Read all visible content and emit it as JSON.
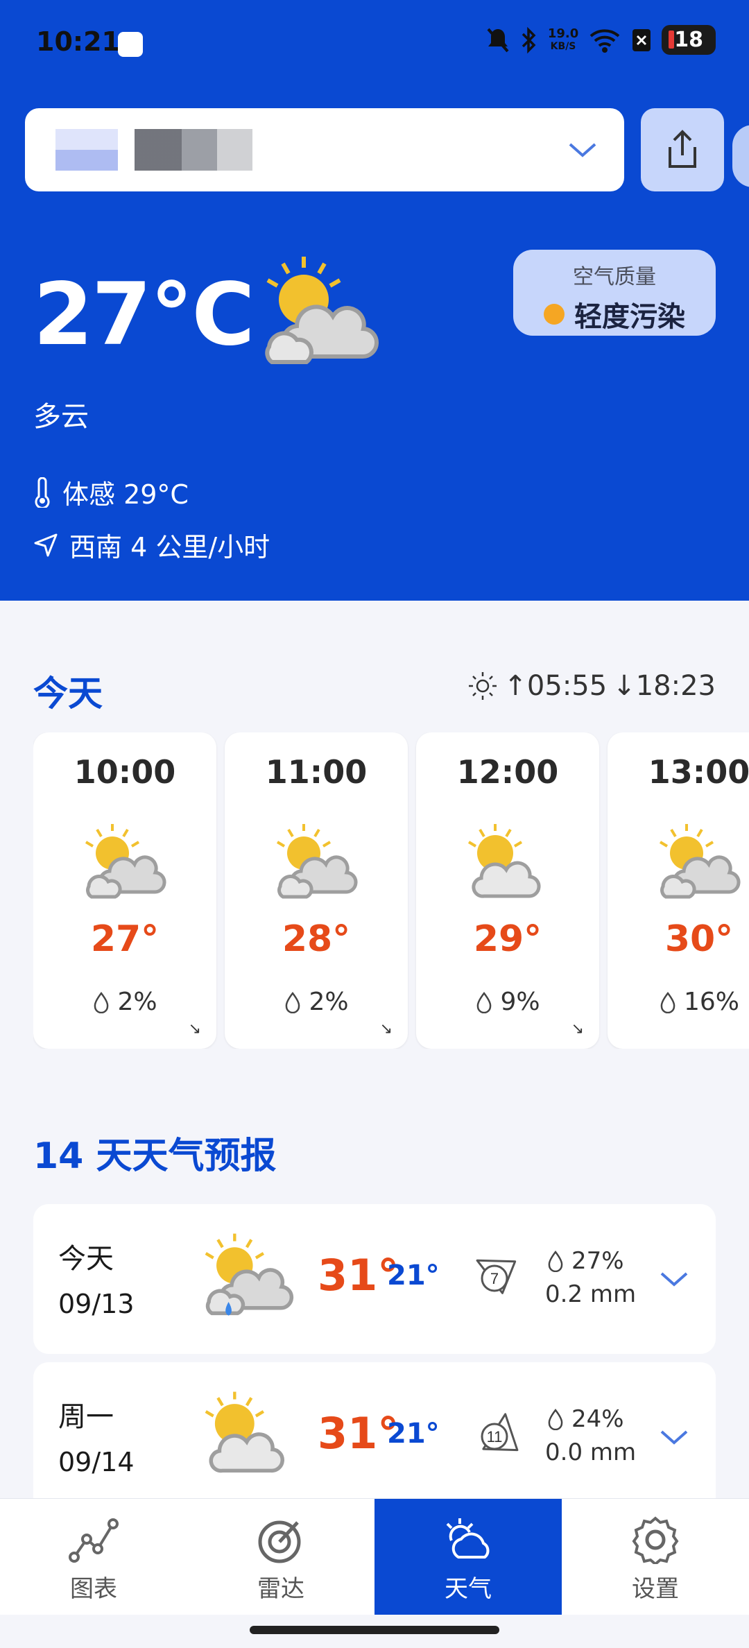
{
  "status_bar": {
    "time": "10:21",
    "net_speed_top": "19.0",
    "net_speed_bottom": "KB/S",
    "battery": "18",
    "icons": [
      "notification-muted-icon",
      "bluetooth-icon",
      "wifi-icon",
      "app-icon"
    ]
  },
  "header": {
    "temperature": "27°C",
    "condition": "多云",
    "feels_like": "体感 29°C",
    "wind": "西南 4 公里/小时",
    "air_quality_label": "空气质量",
    "air_quality_value": "轻度污染"
  },
  "today": {
    "title": "今天",
    "sunrise": "↑05:55",
    "sunset": "↓18:23",
    "hours": [
      {
        "time": "10:00",
        "temp": "27°",
        "precip": "2%",
        "icon": "partly-cloudy"
      },
      {
        "time": "11:00",
        "temp": "28°",
        "precip": "2%",
        "icon": "partly-cloudy"
      },
      {
        "time": "12:00",
        "temp": "29°",
        "precip": "9%",
        "icon": "mostly-sunny"
      },
      {
        "time": "13:00",
        "temp": "30°",
        "precip": "16%",
        "icon": "partly-cloudy"
      }
    ]
  },
  "forecast": {
    "title": "14 天天气预报",
    "days": [
      {
        "name": "今天",
        "date": "09/13",
        "high": "31°",
        "low": "21°",
        "wind": "7",
        "precip": "27%",
        "amount": "0.2 mm",
        "icon": "rain-partly-cloudy"
      },
      {
        "name": "周一",
        "date": "09/14",
        "high": "31°",
        "low": "21°",
        "wind": "11",
        "precip": "24%",
        "amount": "0.0 mm",
        "icon": "mostly-sunny"
      }
    ]
  },
  "nav": {
    "items": [
      {
        "label": "图表",
        "icon": "chart-icon"
      },
      {
        "label": "雷达",
        "icon": "radar-icon"
      },
      {
        "label": "天气",
        "icon": "weather-icon",
        "active": true
      },
      {
        "label": "设置",
        "icon": "settings-icon"
      }
    ]
  },
  "colors": {
    "primary": "#0a49d2",
    "hot": "#e64a19",
    "aq_dot": "#f5a623"
  }
}
